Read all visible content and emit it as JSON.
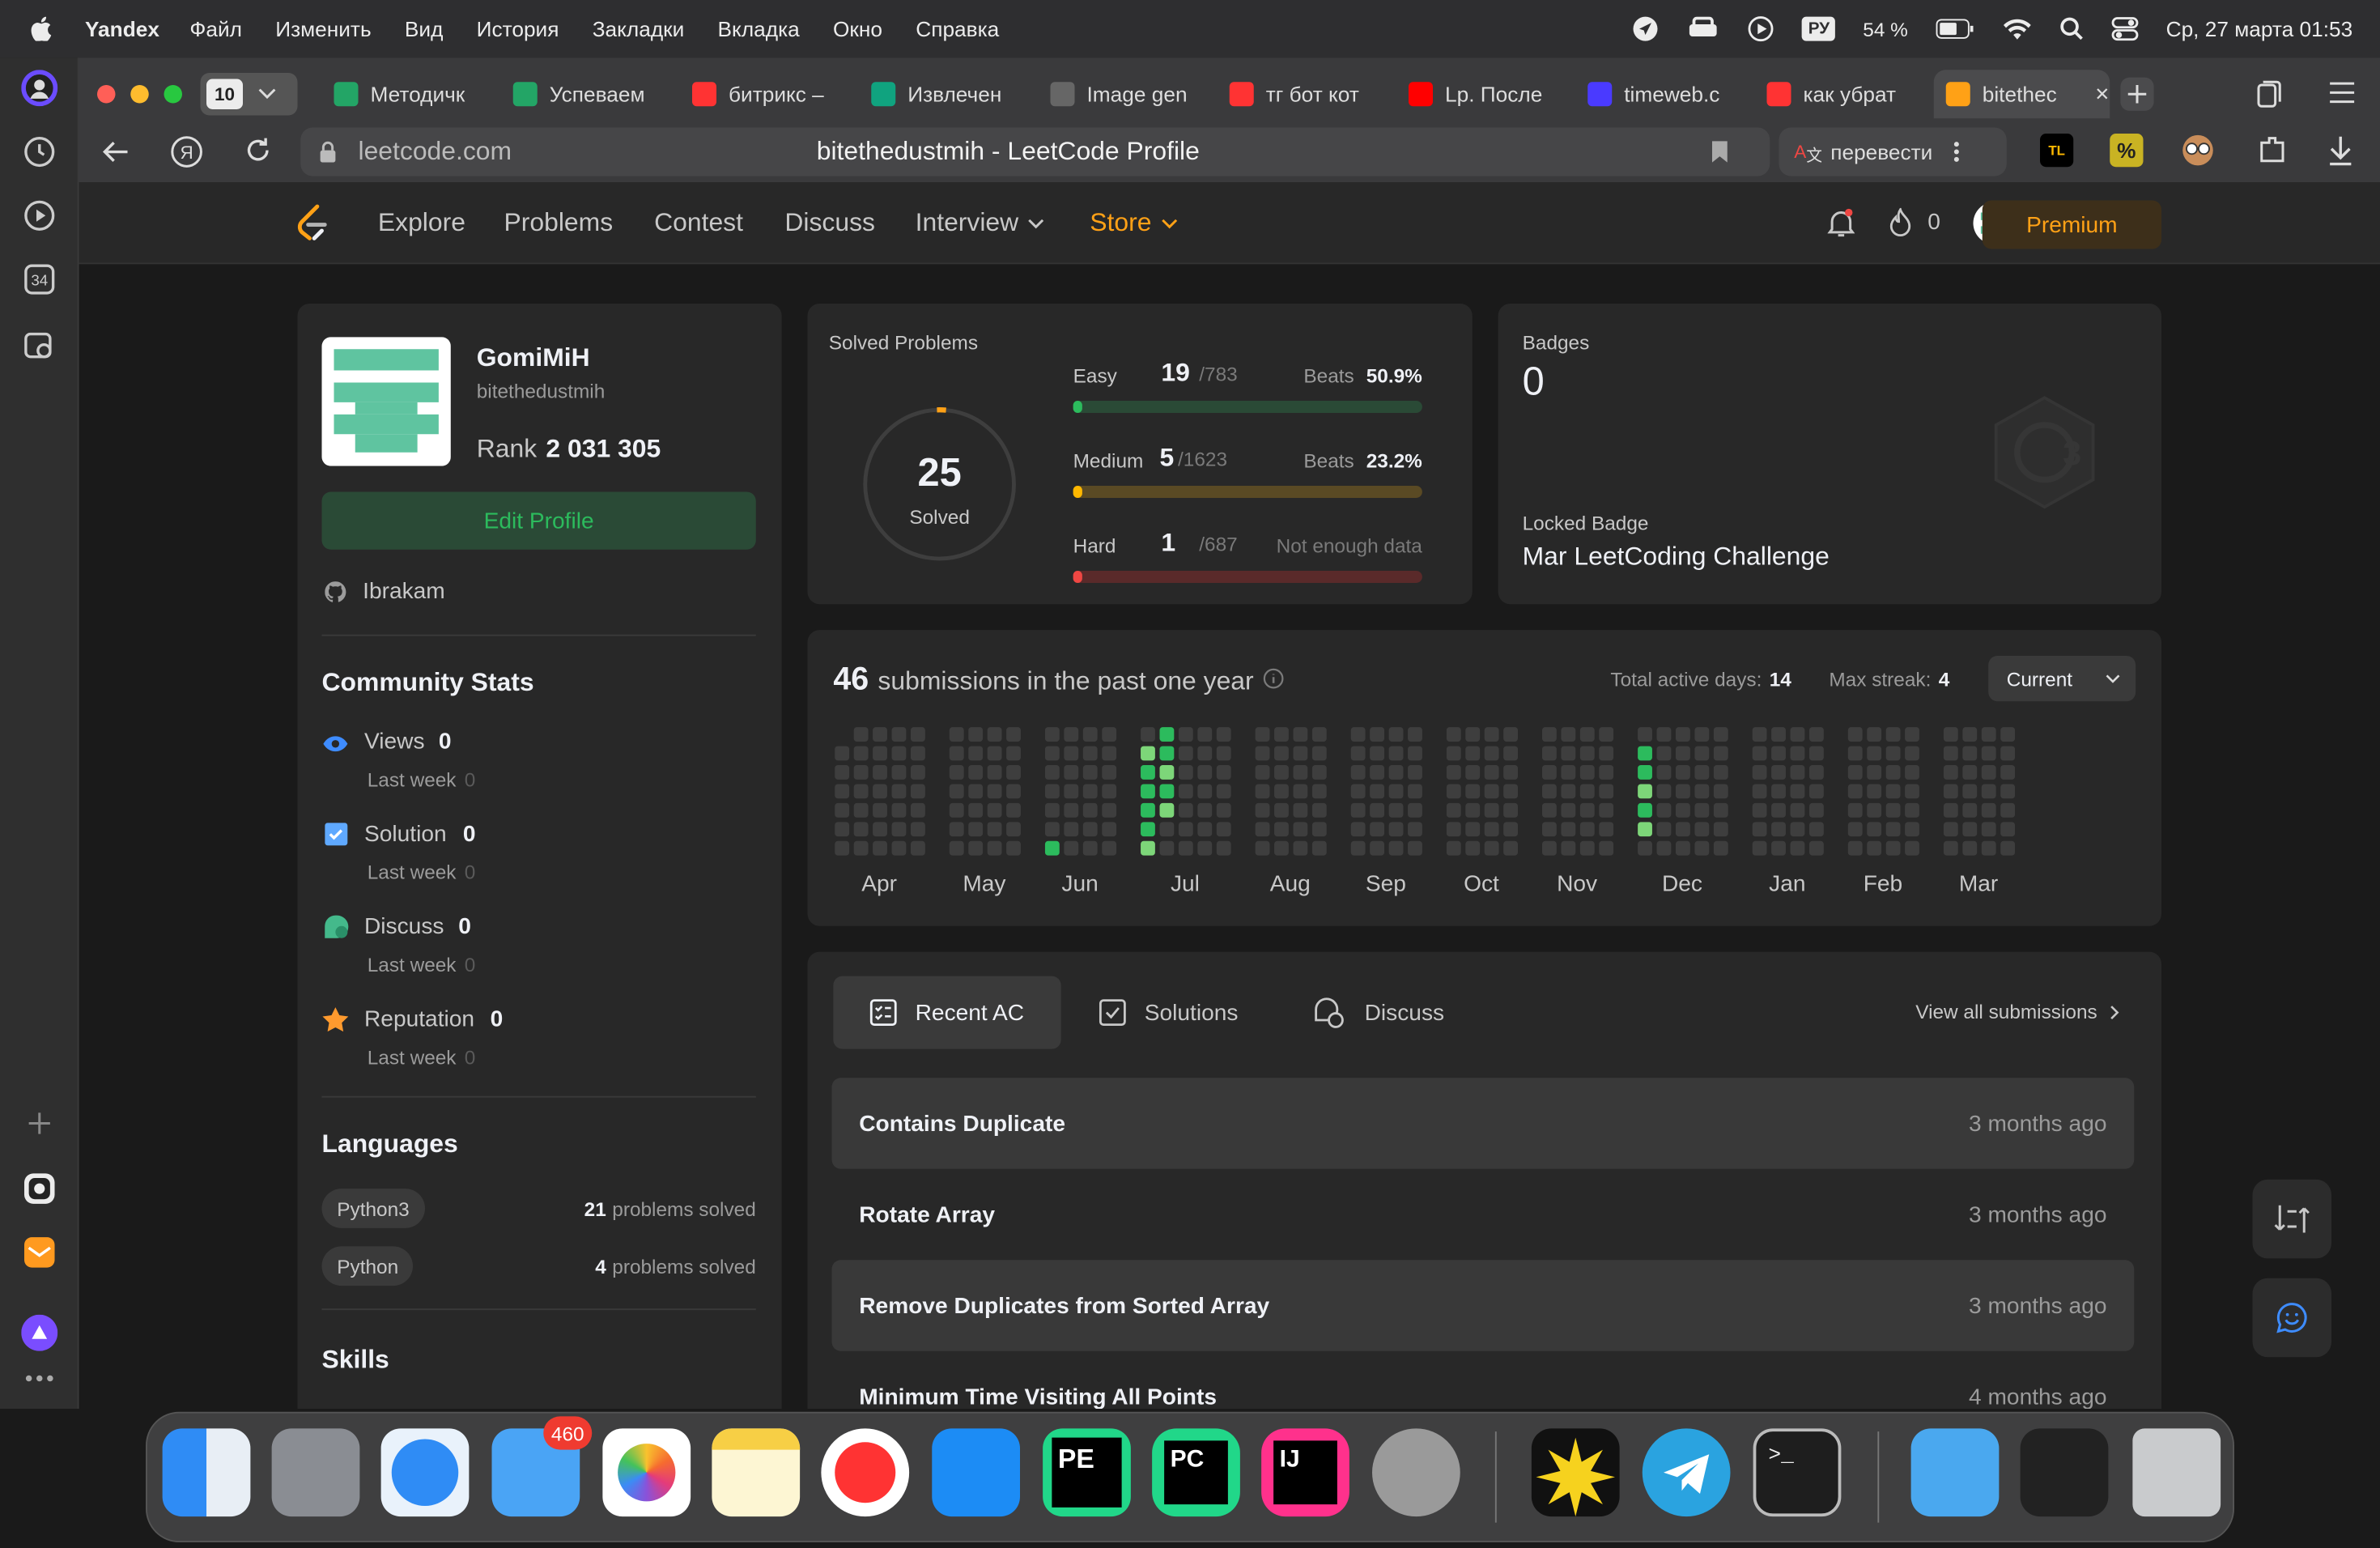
{
  "menubar": {
    "app_name": "Yandex",
    "items": [
      "Файл",
      "Изменить",
      "Вид",
      "История",
      "Закладки",
      "Вкладка",
      "Окно",
      "Справка"
    ],
    "keyboard_layout": "РУ",
    "battery": "54 %",
    "datetime": "Ср, 27 марта  01:53"
  },
  "browser": {
    "tab_count": "10",
    "tabs": [
      {
        "label": "Методичк",
        "favicon": "sheets-icon",
        "color": "#23a566"
      },
      {
        "label": "Успеваем",
        "favicon": "sheets-icon",
        "color": "#23a566"
      },
      {
        "label": "битрикс –",
        "favicon": "yandex-icon",
        "color": "#f33"
      },
      {
        "label": "Извлечен",
        "favicon": "openai-icon",
        "color": "#10a37f"
      },
      {
        "label": "Image gen",
        "favicon": "openai-icon",
        "color": "#666"
      },
      {
        "label": "тг бот кот",
        "favicon": "yandex-icon",
        "color": "#f33"
      },
      {
        "label": "Lp. После",
        "favicon": "youtube-icon",
        "color": "#f00"
      },
      {
        "label": "timeweb.c",
        "favicon": "timeweb-icon",
        "color": "#4a3aff"
      },
      {
        "label": "как убрат",
        "favicon": "yandex-icon",
        "color": "#f33"
      },
      {
        "label": "bitethec",
        "favicon": "leetcode-icon",
        "color": "#ffa116",
        "active": true
      }
    ],
    "address_domain": "leetcode.com",
    "page_title": "bitethedustmih - LeetCode Profile",
    "translate_label": "перевести"
  },
  "lc_nav": {
    "items": [
      "Explore",
      "Problems",
      "Contest",
      "Discuss",
      "Interview"
    ],
    "store": "Store",
    "streak_count": "0",
    "premium": "Premium"
  },
  "profile": {
    "display_name": "GomiMiH",
    "username": "bitethedustmih",
    "rank_label": "Rank",
    "rank_value": "2 031 305",
    "edit_profile": "Edit Profile",
    "github": "Ibrakam",
    "community_title": "Community Stats",
    "stats": [
      {
        "label": "Views",
        "value": "0",
        "last_week_label": "Last week",
        "last_week": "0"
      },
      {
        "label": "Solution",
        "value": "0",
        "last_week_label": "Last week",
        "last_week": "0"
      },
      {
        "label": "Discuss",
        "value": "0",
        "last_week_label": "Last week",
        "last_week": "0"
      },
      {
        "label": "Reputation",
        "value": "0",
        "last_week_label": "Last week",
        "last_week": "0"
      }
    ],
    "languages_title": "Languages",
    "languages": [
      {
        "name": "Python3",
        "count": "21",
        "suffix": "problems solved"
      },
      {
        "name": "Python",
        "count": "4",
        "suffix": "problems solved"
      }
    ],
    "skills_title": "Skills"
  },
  "solved": {
    "title": "Solved Problems",
    "total": "25",
    "total_label": "Solved",
    "rows": [
      {
        "level": "Easy",
        "solved": "19",
        "total": "/783",
        "beats_label": "Beats",
        "beats": "50.9%",
        "fraction": 0.0243,
        "color": "#2cbb5d",
        "track": "#2a4a36"
      },
      {
        "level": "Medium",
        "solved": "5",
        "total": "/1623",
        "beats_label": "Beats",
        "beats": "23.2%",
        "fraction": 0.0031,
        "color": "#ffb800",
        "track": "#5a4a24"
      },
      {
        "level": "Hard",
        "solved": "1",
        "total": "/687",
        "beats_label": "",
        "beats": "Not enough data",
        "fraction": 0.0015,
        "color": "#ef4743",
        "track": "#5a2a2a"
      }
    ]
  },
  "badges": {
    "title": "Badges",
    "count": "0",
    "locked_label": "Locked Badge",
    "locked_name": "Mar LeetCoding Challenge"
  },
  "calendar": {
    "count": "46",
    "label": "submissions in the past one year",
    "active_days_label": "Total active days:",
    "active_days": "14",
    "max_streak_label": "Max streak:",
    "max_streak": "4",
    "select": "Current",
    "months": [
      "Apr",
      "May",
      "Jun",
      "Jul",
      "Aug",
      "Sep",
      "Oct",
      "Nov",
      "Dec",
      "Jan",
      "Feb",
      "Mar"
    ]
  },
  "recent": {
    "tabs": [
      "Recent AC",
      "Solutions",
      "Discuss"
    ],
    "view_all": "View all submissions",
    "items": [
      {
        "title": "Contains Duplicate",
        "time": "3 months ago"
      },
      {
        "title": "Rotate Array",
        "time": "3 months ago"
      },
      {
        "title": "Remove Duplicates from Sorted Array",
        "time": "3 months ago"
      },
      {
        "title": "Minimum Time Visiting All Points",
        "time": "4 months ago"
      }
    ]
  },
  "dock": {
    "mail_badge": "460"
  }
}
